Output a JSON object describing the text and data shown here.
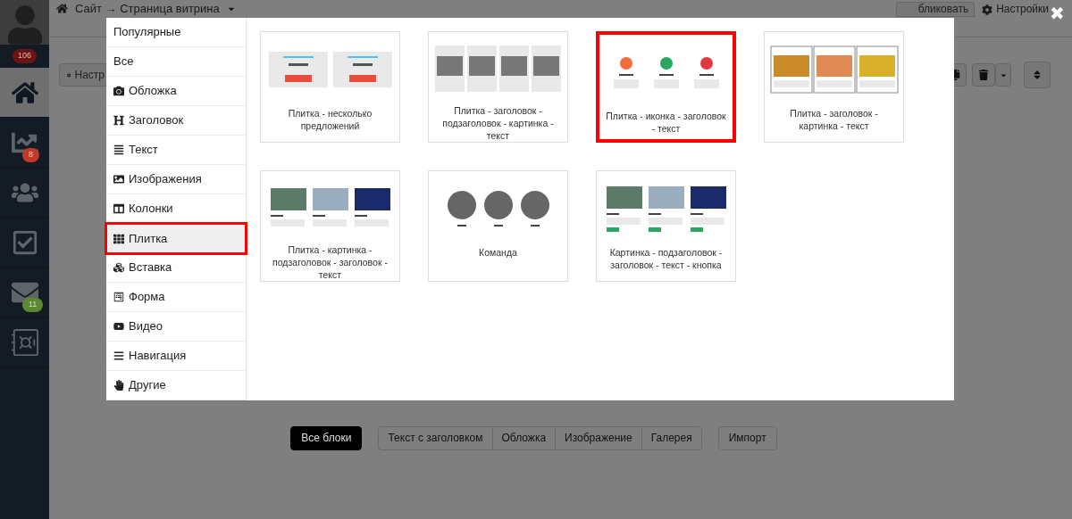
{
  "sidebar": {
    "profile_badge": "106",
    "items": [
      {
        "kind": "home",
        "selected": true
      },
      {
        "kind": "chart",
        "selected": false,
        "badge": {
          "count": "8",
          "color": "#c0392b"
        }
      },
      {
        "kind": "users",
        "selected": false
      },
      {
        "kind": "tasks",
        "selected": false
      },
      {
        "kind": "mail",
        "selected": false,
        "badge": {
          "count": "11",
          "color": "#5b8a2e"
        }
      },
      {
        "kind": "safe",
        "selected": false
      }
    ]
  },
  "topbar": {
    "breadcrumb": "Сайт → Страница витрина",
    "publish_partial": "бликовать",
    "settings": "Настройки",
    "settings_button_partial": "Настр"
  },
  "modal": {
    "close": "✖",
    "categories": [
      {
        "kind": "plain",
        "label": "Популярные",
        "selected": false
      },
      {
        "kind": "plain",
        "label": "Все",
        "selected": false
      },
      {
        "kind": "cover",
        "label": "Обложка",
        "selected": false
      },
      {
        "kind": "heading",
        "label": "Заголовок",
        "selected": false
      },
      {
        "kind": "text",
        "label": "Текст",
        "selected": false
      },
      {
        "kind": "image",
        "label": "Изображения",
        "selected": false
      },
      {
        "kind": "columns",
        "label": "Колонки",
        "selected": false
      },
      {
        "kind": "tiles",
        "label": "Плитка",
        "selected": true
      },
      {
        "kind": "embed",
        "label": "Вставка",
        "selected": false
      },
      {
        "kind": "form",
        "label": "Форма",
        "selected": false
      },
      {
        "kind": "video",
        "label": "Видео",
        "selected": false
      },
      {
        "kind": "nav",
        "label": "Навигация",
        "selected": false
      },
      {
        "kind": "other",
        "label": "Другие",
        "selected": false
      }
    ],
    "templates": [
      {
        "kind": "offers",
        "caption": "Плитка - несколько предложений",
        "highlighted": false
      },
      {
        "kind": "portraits",
        "caption": "Плитка - заголовок - подзаголовок - картинка - текст",
        "highlighted": false
      },
      {
        "kind": "icons",
        "caption": "Плитка - иконка - заголовок - текст",
        "highlighted": true
      },
      {
        "kind": "framed",
        "caption": "Плитка - заголовок - картинка - текст",
        "highlighted": false
      },
      {
        "kind": "pictures",
        "caption": "Плитка - картинка - подзаголовок - заголовок - текст",
        "highlighted": false
      },
      {
        "kind": "team",
        "caption": "Команда",
        "highlighted": false
      },
      {
        "kind": "buttons",
        "caption": "Картинка - подзаголовок - заголовок - текст - кнопка",
        "highlighted": false
      }
    ]
  },
  "bottom_bar": {
    "filters": [
      {
        "label": "Все блоки",
        "selected": true
      },
      {
        "label": "Текст с заголовком",
        "selected": false
      },
      {
        "label": "Обложка",
        "selected": false
      },
      {
        "label": "Изображение",
        "selected": false
      },
      {
        "label": "Галерея",
        "selected": false
      }
    ],
    "import": "Импорт"
  }
}
